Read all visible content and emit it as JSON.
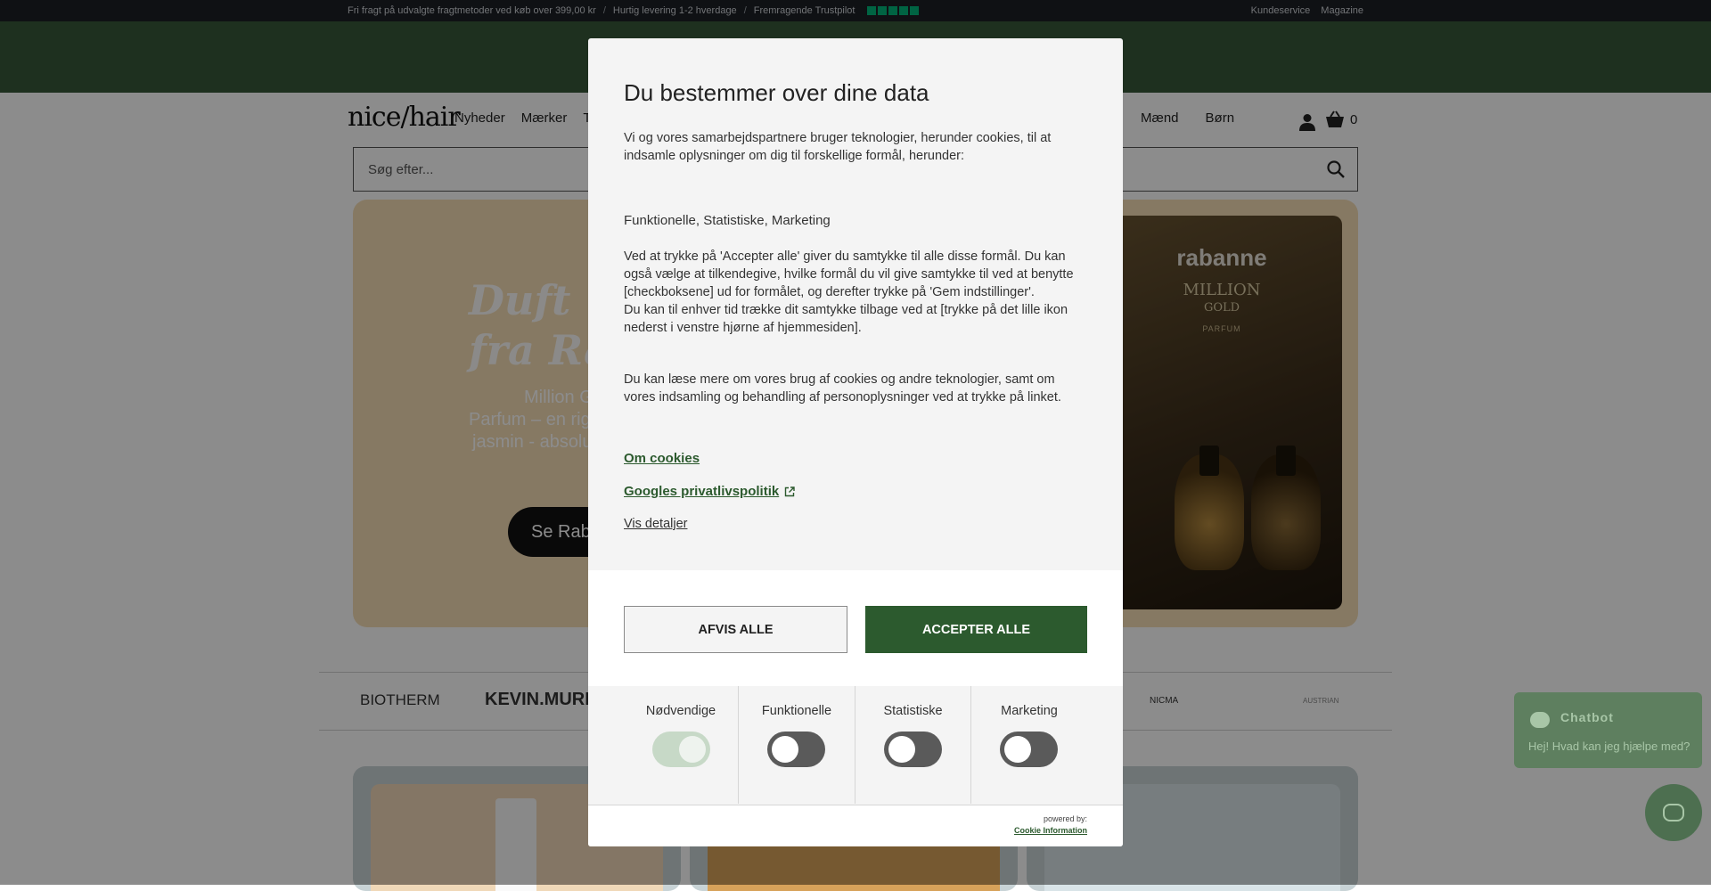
{
  "topbar": {
    "shipping": "Fri fragt på udvalgte fragtmetoder ved køb over 399,00 kr",
    "sep": "/",
    "delivery": "Hurtig levering 1-2 hverdage",
    "trustpilot": "Fremragende Trustpilot",
    "customer_service": "Kundeservice",
    "magazine": "Magazine"
  },
  "header": {
    "logo": "nice/hair",
    "nav": [
      "Nyheder",
      "Mærker",
      "Tilb"
    ],
    "nav_right": [
      "Mænd",
      "Børn"
    ],
    "cart_count": "0",
    "search_placeholder": "Søg efter..."
  },
  "hero": {
    "title_line1": "Duft",
    "title_line2": "fra Ra",
    "text_line1": "Million G",
    "text_line2": "Parfum – en rig",
    "text_line3": "jasmin - absolu",
    "button": "Se Rab",
    "image_brand": "rabanne",
    "image_product_line1": "MILLION",
    "image_product_line2": "GOLD",
    "image_product_sub": "PARFUM"
  },
  "brands": [
    "BIOTHERM",
    "KEVIN.MURF",
    "NICMA",
    "AUSTRIAN"
  ],
  "chatbot": {
    "title": "Chatbot",
    "subtitle": "Hej! Hvad kan jeg hjælpe med?"
  },
  "consent": {
    "title": "Du bestemmer over dine data",
    "intro": "Vi og vores samarbejdspartnere bruger teknologier, herunder cookies, til at indsamle oplysninger om dig til forskellige formål, herunder:",
    "purposes": "Funktionelle, Statistiske, Marketing",
    "explain1": "Ved at trykke på 'Accepter alle' giver du samtykke til alle disse formål. Du kan også vælge at tilkendegive, hvilke formål du vil give samtykke til ved at benytte [checkboksene] ud for formålet, og derefter trykke på 'Gem indstillinger'.",
    "explain2": "Du kan til enhver tid trække dit samtykke tilbage ved at [trykke på det lille ikon nederst i venstre hjørne af hjemmesiden].",
    "read_more": "Du kan læse mere om vores brug af cookies og andre teknologier, samt om vores indsamling og behandling af personoplysninger ved at trykke på linket.",
    "link_cookies": "Om cookies",
    "link_google": "Googles privatlivspolitik",
    "link_details": "Vis detaljer",
    "reject": "AFVIS ALLE",
    "accept": "ACCEPTER ALLE",
    "categories": [
      {
        "label": "Nødvendige",
        "enabled": true
      },
      {
        "label": "Funktionelle",
        "enabled": false
      },
      {
        "label": "Statistiske",
        "enabled": false
      },
      {
        "label": "Marketing",
        "enabled": false
      }
    ],
    "powered_by": "powered by:",
    "provider": "Cookie Information"
  },
  "colors": {
    "accent_green": "#2c5a2e",
    "promo_green": "#38583a",
    "topbar": "#1c1f26",
    "trustpilot_green": "#00b67a"
  }
}
